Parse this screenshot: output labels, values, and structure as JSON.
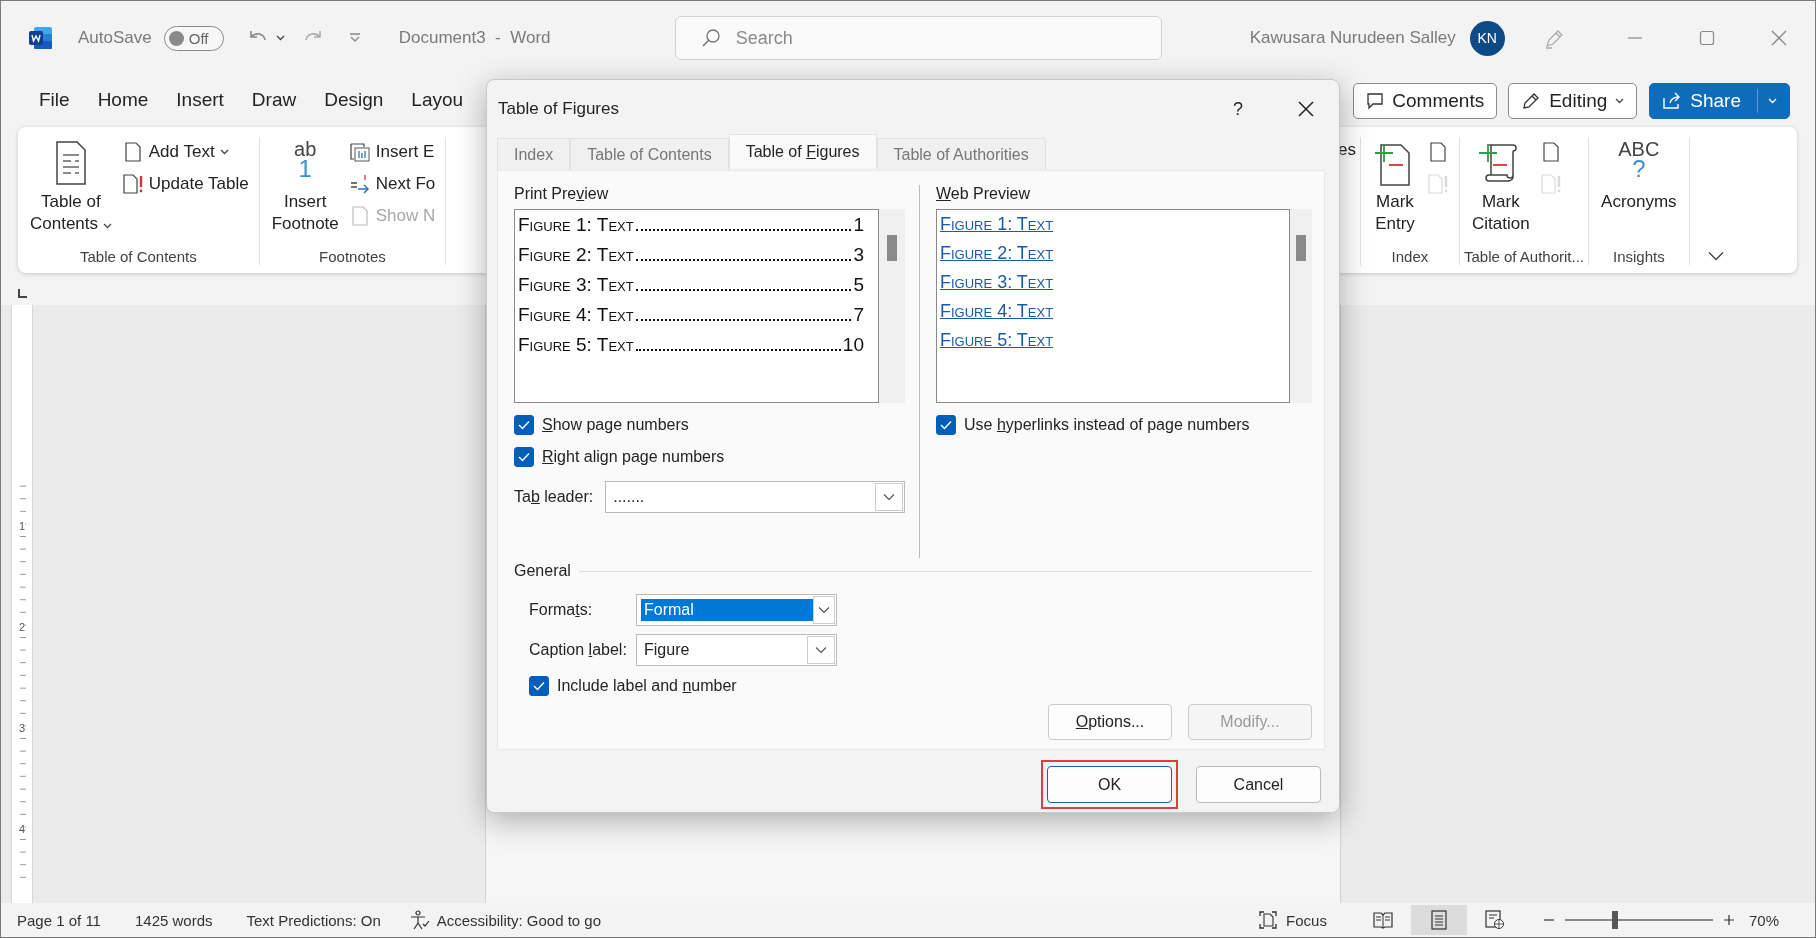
{
  "title_bar": {
    "autosave_label": "AutoSave",
    "autosave": {
      "on": false,
      "label": "Off"
    },
    "document_title": "Document3  -  Word",
    "search": {
      "placeholder": "Search"
    },
    "user_name": "Kawusara Nurudeen Salley",
    "avatar_initials": "KN"
  },
  "menu_tabs": [
    {
      "label": "File",
      "selected": false
    },
    {
      "label": "Home",
      "selected": false
    },
    {
      "label": "Insert",
      "selected": false
    },
    {
      "label": "Draw",
      "selected": false
    },
    {
      "label": "Design",
      "selected": false
    },
    {
      "label": "Layou",
      "selected": false
    }
  ],
  "menu_buttons": [
    {
      "kind": "comments",
      "label": "Comments"
    },
    {
      "kind": "editing",
      "label": "Editing"
    },
    {
      "kind": "share",
      "label": "Share"
    }
  ],
  "ribbon": {
    "left_groups": [
      {
        "label": "Table of Contents",
        "buttons": [
          {
            "kind": "large",
            "label_lines": [
              "Table of",
              "Contents"
            ],
            "caret": true,
            "disabled": false
          },
          {
            "kind": "small",
            "label_lines": [
              "Add Text"
            ],
            "caret": true,
            "disabled": false
          },
          {
            "kind": "small",
            "label_lines": [
              "Update Table"
            ],
            "caret": false,
            "disabled": false
          }
        ]
      },
      {
        "label": "Footnotes",
        "buttons": [
          {
            "kind": "large",
            "label_lines": [
              "Insert",
              "Footnote"
            ],
            "icon_text": "ab",
            "icon_sup": "1",
            "caret": false,
            "disabled": false
          },
          {
            "kind": "small",
            "label_lines": [
              "Insert E"
            ],
            "caret": false,
            "disabled": false
          },
          {
            "kind": "small",
            "label_lines": [
              "Next Fo"
            ],
            "caret": false,
            "disabled": false
          },
          {
            "kind": "small",
            "label_lines": [
              "Show N"
            ],
            "caret": false,
            "disabled": true
          }
        ]
      }
    ],
    "cut_text": "es",
    "right_groups": [
      {
        "label": "Index",
        "buttons": [
          {
            "kind": "large",
            "label_lines": [
              "Mark",
              "Entry"
            ],
            "caret": false,
            "disabled": false
          },
          {
            "kind": "icon",
            "disabled": false
          },
          {
            "kind": "icon",
            "disabled": true
          }
        ]
      },
      {
        "label": "Table of Authorit...",
        "buttons": [
          {
            "kind": "large",
            "label_lines": [
              "Mark",
              "Citation"
            ],
            "caret": false,
            "disabled": false
          },
          {
            "kind": "icon",
            "disabled": false
          },
          {
            "kind": "icon",
            "disabled": true
          }
        ]
      },
      {
        "label": "Insights",
        "buttons": [
          {
            "kind": "large",
            "label_lines": [
              "Acronyms"
            ],
            "icon_text": "ABC",
            "icon_sup": "?",
            "caret": false,
            "disabled": false
          }
        ]
      }
    ]
  },
  "vertical_ruler": [
    "1",
    "2",
    "3",
    "4"
  ],
  "dialog": {
    "title": "Table of Figures",
    "help": "?",
    "tabs": [
      {
        "label": {
          "after": "Index"
        },
        "selected": false
      },
      {
        "label": {
          "after": "Table of Contents"
        },
        "selected": false
      },
      {
        "label": {
          "before": "Table of ",
          "key": "F",
          "after": "igures"
        },
        "selected": true
      },
      {
        "label": {
          "after": "Table of Authorities"
        },
        "selected": false
      }
    ],
    "print_preview": {
      "label": {
        "before": "Print Pre",
        "key": "v",
        "after": "iew"
      },
      "entries": [
        {
          "caption": "Figure 1: Text",
          "page": "1"
        },
        {
          "caption": "Figure 2: Text",
          "page": "3"
        },
        {
          "caption": "Figure 3: Text",
          "page": "5"
        },
        {
          "caption": "Figure 4: Text",
          "page": "7"
        },
        {
          "caption": "Figure 5: Text",
          "page": "10"
        }
      ]
    },
    "web_preview": {
      "label": {
        "key": "W",
        "after": "eb Preview"
      },
      "links": [
        "Figure 1: Text",
        "Figure 2: Text",
        "Figure 3: Text",
        "Figure 4: Text",
        "Figure 5: Text"
      ]
    },
    "print_options": [
      {
        "label": {
          "key": "S",
          "after": "how page numbers"
        },
        "checked": true
      },
      {
        "label": {
          "key": "R",
          "after": "ight align page numbers"
        },
        "checked": true
      }
    ],
    "tab_leader": {
      "label": {
        "before": "Ta",
        "key": "b",
        "after": " leader:"
      },
      "value": "......."
    },
    "web_options": [
      {
        "label": {
          "before": "Use ",
          "key": "h",
          "after": "yperlinks instead of page numbers"
        },
        "checked": true
      }
    ],
    "general": {
      "label": "General",
      "formats": {
        "label": {
          "before": "Forma",
          "key": "t",
          "after": "s:"
        },
        "value": "Formal",
        "highlighted": true
      },
      "caption_label": {
        "label": {
          "before": "Caption ",
          "key": "l",
          "after": "abel:"
        },
        "value": "Figure",
        "highlighted": false
      },
      "include": {
        "label": {
          "before": "Include label and ",
          "key": "n",
          "after": "umber"
        },
        "checked": true
      }
    },
    "buttons": [
      {
        "label": {
          "key": "O",
          "after": "ptions..."
        },
        "disabled": false
      },
      {
        "label": {
          "after": "Modify..."
        },
        "disabled": true
      }
    ],
    "footer_buttons": [
      {
        "label": "OK",
        "highlighted": true
      },
      {
        "label": "Cancel",
        "highlighted": false
      }
    ]
  },
  "status_bar": {
    "items": [
      "Page 1 of 11",
      "1425 words",
      "Text Predictions: On"
    ],
    "accessibility": "Accessibility: Good to go",
    "focus": "Focus",
    "views": [
      {
        "selected": false
      },
      {
        "selected": true
      },
      {
        "selected": false
      }
    ],
    "zoom": {
      "level": 0.34,
      "reading": "70%"
    }
  }
}
